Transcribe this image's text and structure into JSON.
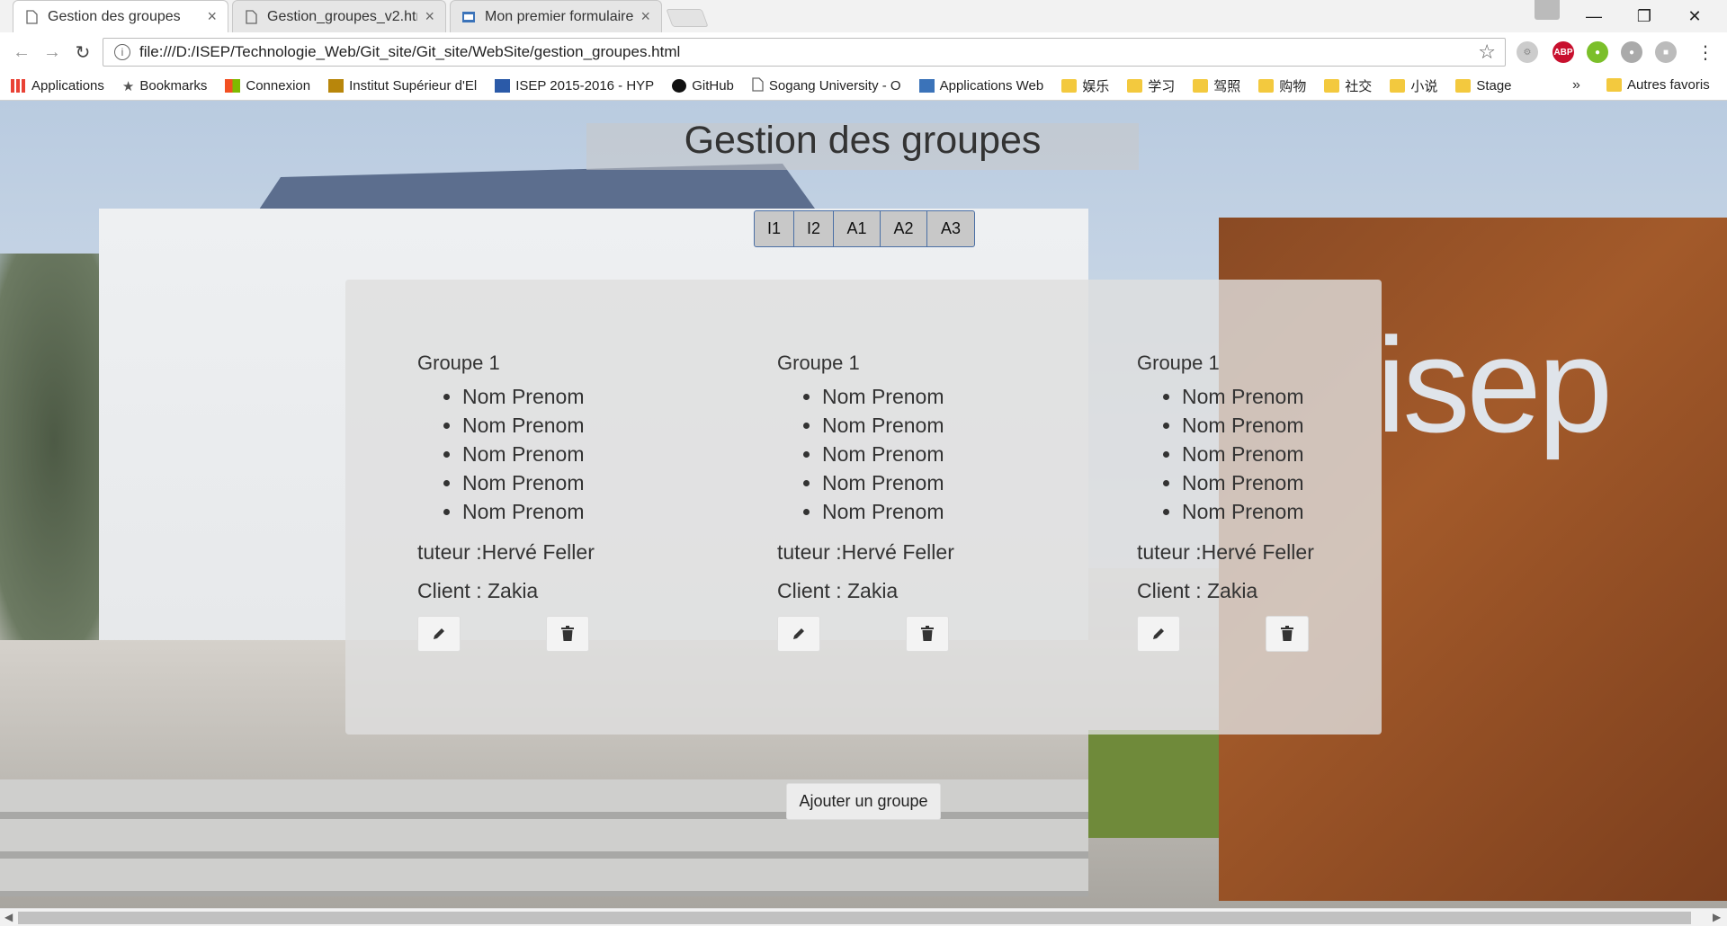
{
  "browser": {
    "tabs": [
      {
        "title": "Gestion des groupes",
        "active": true
      },
      {
        "title": "Gestion_groupes_v2.html",
        "active": false
      },
      {
        "title": "Mon premier formulaire",
        "active": false
      }
    ],
    "close_glyph": "×",
    "url": "file:///D:/ISEP/Technologie_Web/Git_site/Git_site/WebSite/gestion_groupes.html",
    "bookmarks": [
      "Applications",
      "Bookmarks",
      "Connexion",
      "Institut Supérieur d'El",
      "ISEP 2015-2016 - HYP",
      "GitHub",
      "Sogang University - O",
      "Applications Web",
      "娱乐",
      "学习",
      "驾照",
      "购物",
      "社交",
      "小说",
      "Stage"
    ],
    "bookmarks_more": "»",
    "other_bookmarks": "Autres favoris"
  },
  "page": {
    "title": "Gestion des groupes",
    "year_tabs": [
      "I1",
      "I2",
      "A1",
      "A2",
      "A3"
    ],
    "groups": [
      {
        "title": "Groupe 1",
        "members": [
          "Nom Prenom",
          "Nom Prenom",
          "Nom Prenom",
          "Nom Prenom",
          "Nom Prenom"
        ],
        "tutor": "tuteur :Hervé Feller",
        "client": "Client : Zakia"
      },
      {
        "title": "Groupe 1",
        "members": [
          "Nom Prenom",
          "Nom Prenom",
          "Nom Prenom",
          "Nom Prenom",
          "Nom Prenom"
        ],
        "tutor": "tuteur :Hervé Feller",
        "client": "Client : Zakia"
      },
      {
        "title": "Groupe 1",
        "members": [
          "Nom Prenom",
          "Nom Prenom",
          "Nom Prenom",
          "Nom Prenom",
          "Nom Prenom"
        ],
        "tutor": "tuteur :Hervé Feller",
        "client": "Client : Zakia"
      }
    ],
    "add_button": "Ajouter un groupe",
    "background_sign_text": "isep"
  }
}
